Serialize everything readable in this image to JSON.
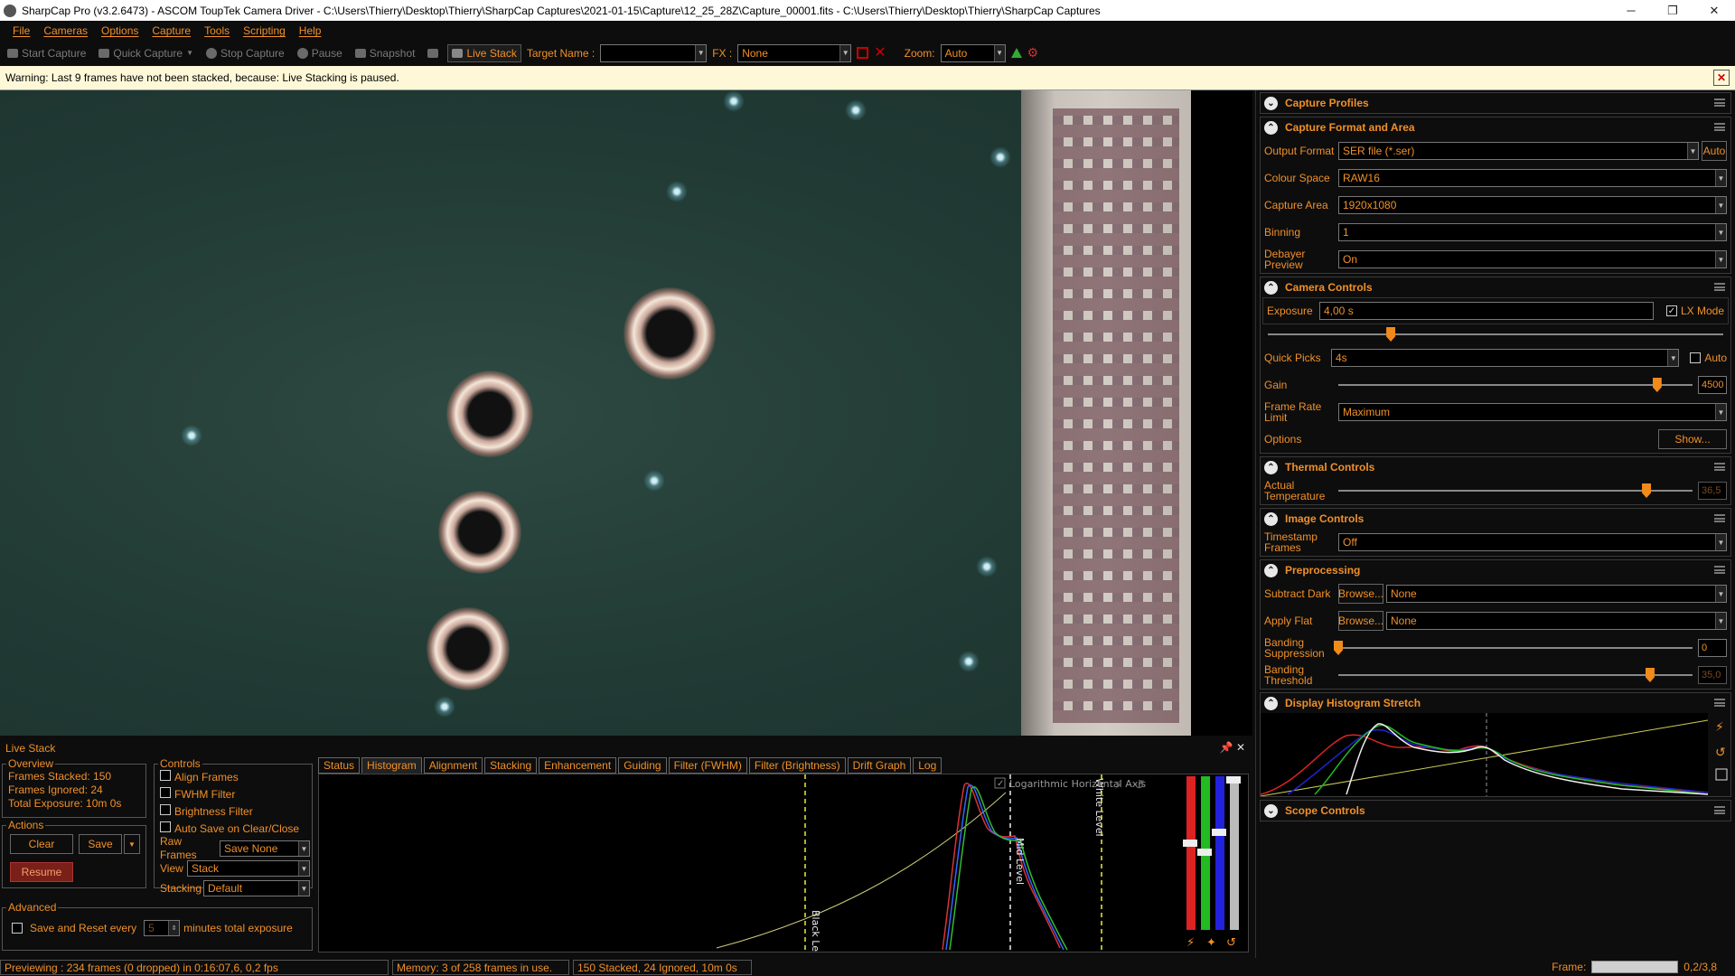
{
  "titlebar": {
    "title": "SharpCap Pro (v3.2.6473) - ASCOM ToupTek Camera Driver - C:\\Users\\Thierry\\Desktop\\Thierry\\SharpCap Captures\\2021-01-15\\Capture\\12_25_28Z\\Capture_00001.fits - C:\\Users\\Thierry\\Desktop\\Thierry\\SharpCap Captures",
    "min": "─",
    "max": "❐",
    "close": "✕"
  },
  "menu": [
    "File",
    "Cameras",
    "Options",
    "Capture",
    "Tools",
    "Scripting",
    "Help"
  ],
  "toolbar": {
    "start": "Start Capture",
    "quick": "Quick Capture",
    "stop": "Stop Capture",
    "pause": "Pause",
    "snapshot": "Snapshot",
    "livestack": "Live Stack",
    "target_label": "Target Name :",
    "target_value": "",
    "fx_label": "FX :",
    "fx_value": "None",
    "zoom_label": "Zoom:",
    "zoom_value": "Auto"
  },
  "warning": {
    "text": "Warning: Last 9 frames have not been stacked, because: Live Stacking is paused.",
    "close": "✕"
  },
  "right": {
    "capture_profiles": "Capture Profiles",
    "format": {
      "title": "Capture Format and Area",
      "output_label": "Output Format",
      "output_value": "SER file (*.ser)",
      "auto": "Auto",
      "colour_label": "Colour Space",
      "colour_value": "RAW16",
      "area_label": "Capture Area",
      "area_value": "1920x1080",
      "binning_label": "Binning",
      "binning_value": "1",
      "debayer_label": "Debayer Preview",
      "debayer_value": "On"
    },
    "camera": {
      "title": "Camera Controls",
      "exposure_label": "Exposure",
      "exposure_value": "4,00 s",
      "lx": "LX Mode",
      "exposure_level": 0.27,
      "quick_label": "Quick Picks",
      "quick_value": "4s",
      "auto": "Auto",
      "gain_label": "Gain",
      "gain_value": "4500",
      "gain_level": 0.9,
      "frl_label": "Frame Rate Limit",
      "frl_value": "Maximum",
      "options_label": "Options",
      "show": "Show..."
    },
    "thermal": {
      "title": "Thermal Controls",
      "temp_label": "Actual Temperature",
      "temp_value": "36,5",
      "temp_level": 0.87
    },
    "image": {
      "title": "Image Controls",
      "ts_label": "Timestamp Frames",
      "ts_value": "Off"
    },
    "pre": {
      "title": "Preprocessing",
      "dark_label": "Subtract Dark",
      "browse": "Browse...",
      "dark_value": "None",
      "flat_label": "Apply Flat",
      "flat_value": "None",
      "band_label": "Banding Suppression",
      "band_value": "0",
      "band_level": 0.0,
      "thr_label": "Banding Threshold",
      "thr_value": "35,0",
      "thr_level": 0.88
    },
    "dhs": {
      "title": "Display Histogram Stretch"
    },
    "scope": {
      "title": "Scope Controls"
    }
  },
  "livestack": {
    "title": "Live Stack",
    "overview_title": "Overview",
    "frames_stacked": "Frames Stacked:  150",
    "frames_ignored": "Frames Ignored:  24",
    "total_exposure": "Total Exposure:   10m 0s",
    "actions_title": "Actions",
    "clear": "Clear",
    "save": "Save",
    "resume": "Resume",
    "advanced_title": "Advanced",
    "save_reset": "Save and Reset every",
    "minutes_value": "5",
    "minutes_label": "minutes total exposure",
    "controls_title": "Controls",
    "align": "Align Frames",
    "fwhm": "FWHM Filter",
    "brightness": "Brightness Filter",
    "autosave": "Auto Save on Clear/Close",
    "raw_label": "Raw Frames",
    "raw_value": "Save None",
    "view_label": "View",
    "view_value": "Stack",
    "stacking_label": "Stacking",
    "stacking_value": "Default",
    "tabs": [
      "Status",
      "Histogram",
      "Alignment",
      "Stacking",
      "Enhancement",
      "Guiding",
      "Filter (FWHM)",
      "Filter (Brightness)",
      "Drift Graph",
      "Log"
    ],
    "log_axis": "Logarithmic Horizontal Axis",
    "black_level": "Black Level",
    "mid_level": "Mid Level",
    "white_level": "White Level"
  },
  "status": {
    "preview": "Previewing : 234 frames (0 dropped) in 0:16:07,6, 0,2 fps",
    "memory": "Memory: 3 of 258 frames in use.",
    "stacked": "150 Stacked, 24 Ignored, 10m 0s",
    "frame_label": "Frame:",
    "frame_value": "0,2/3,8"
  }
}
